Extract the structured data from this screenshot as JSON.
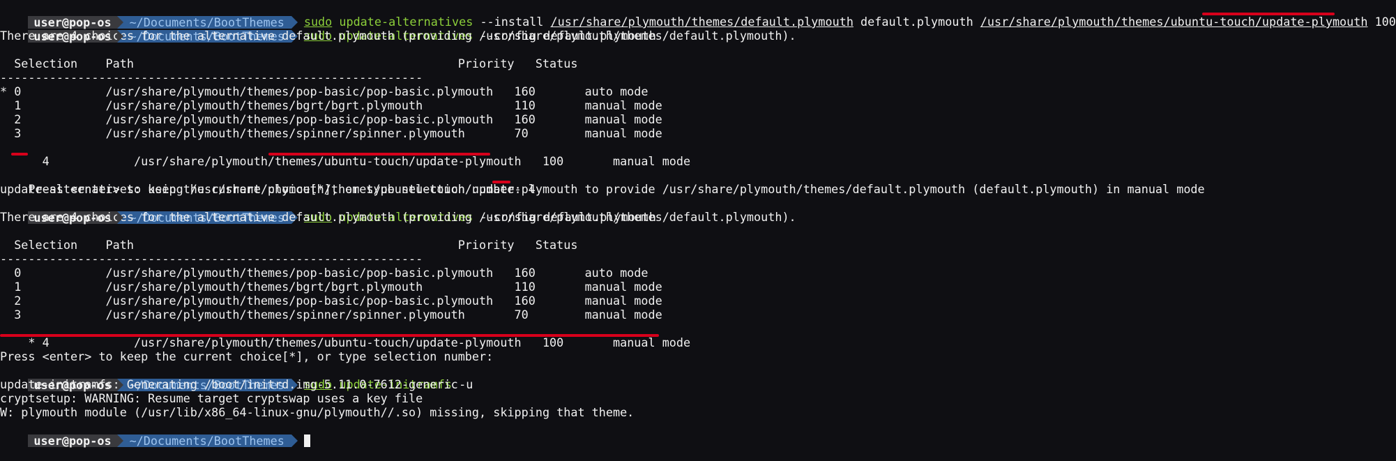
{
  "prompt": {
    "user": "user@pop-os",
    "dir": "~/Documents/BootThemes"
  },
  "colors": {
    "prompt_user_bg": "#3a3a3e",
    "prompt_dir_bg": "#2f5d95",
    "command": "#8ccf3a",
    "highlight": "#d7001b"
  },
  "cmd1": {
    "sudo": "sudo",
    "cmd": "update-alternatives",
    "opt": " --install ",
    "a1": "/usr/share/plymouth/themes/default.plymouth",
    "a2": " default.plymouth ",
    "a3": "/usr/share/plymouth/themes/ubuntu-touch/update-plymouth",
    "a4": " 100"
  },
  "cmd2": {
    "sudo": "sudo",
    "cmd": "update-alternatives",
    "rest": " --config default.plymouth"
  },
  "choices_msg": "There are 4 choices for the alternative default.plymouth (providing /usr/share/plymouth/themes/default.plymouth).",
  "header": "  Selection    Path                                              Priority   Status",
  "divider": "------------------------------------------------------------",
  "table1": [
    "* 0            /usr/share/plymouth/themes/pop-basic/pop-basic.plymouth   160       auto mode",
    "  1            /usr/share/plymouth/themes/bgrt/bgrt.plymouth             110       manual mode",
    "  2            /usr/share/plymouth/themes/pop-basic/pop-basic.plymouth   160       manual mode",
    "  3            /usr/share/plymouth/themes/spinner/spinner.plymouth       70        manual mode",
    "  4            /usr/share/plymouth/themes/ubuntu-touch/update-plymouth   100       manual mode"
  ],
  "press1": "Press <enter> to keep the current choice[*], or type selection number: 4",
  "using": "update-alternatives: using /usr/share/plymouth/themes/ubuntu-touch/update-plymouth to provide /usr/share/plymouth/themes/default.plymouth (default.plymouth) in manual mode",
  "cmd3": {
    "sudo": "sudo",
    "cmd": "update-alternatives",
    "rest": " --config default.plymouth"
  },
  "table2": [
    "  0            /usr/share/plymouth/themes/pop-basic/pop-basic.plymouth   160       auto mode",
    "  1            /usr/share/plymouth/themes/bgrt/bgrt.plymouth             110       manual mode",
    "  2            /usr/share/plymouth/themes/pop-basic/pop-basic.plymouth   160       manual mode",
    "  3            /usr/share/plymouth/themes/spinner/spinner.plymouth       70        manual mode",
    "* 4            /usr/share/plymouth/themes/ubuntu-touch/update-plymouth   100       manual mode"
  ],
  "press2": "Press <enter> to keep the current choice[*], or type selection number:",
  "cmd4": {
    "sudo": "sudo",
    "cmd": "update-initramfs",
    "rest": " -u"
  },
  "init_out": [
    "update-initramfs: Generating /boot/initrd.img-5.11.0-7612-generic",
    "cryptsetup: WARNING: Resume target cryptswap uses a key file",
    "W: plymouth module (/usr/lib/x86_64-linux-gnu/plymouth//.so) missing, skipping that theme."
  ]
}
